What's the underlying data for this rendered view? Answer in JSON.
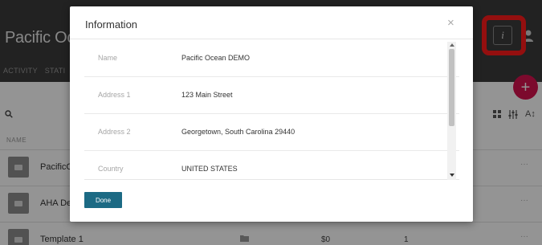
{
  "app": {
    "title": "Pacific Ocea",
    "tabs": [
      "ACTIVITY",
      "STATI"
    ],
    "info_button": "i",
    "add_button": "+",
    "column_header": "NAME",
    "toolbar_sort": "A↕",
    "rows": [
      {
        "name": "PacificOc",
        "col2": "",
        "col3": "",
        "col4": "",
        "more": "···"
      },
      {
        "name": "AHA Der",
        "col2": "",
        "col3": "",
        "col4": "",
        "more": "···"
      },
      {
        "name": "Template 1",
        "col2": "",
        "col3": "$0",
        "col4": "1",
        "more": "···"
      }
    ]
  },
  "modal": {
    "title": "Information",
    "close": "×",
    "fields": [
      {
        "label": "Name",
        "value": "Pacific Ocean DEMO"
      },
      {
        "label": "Address 1",
        "value": "123 Main Street"
      },
      {
        "label": "Address 2",
        "value": "Georgetown, South Carolina 29440"
      },
      {
        "label": "Country",
        "value": "UNITED STATES"
      }
    ],
    "done": "Done"
  },
  "colors": {
    "header_bg": "#3b3b3b",
    "accent": "#d6124f",
    "highlight": "#ff1a1a",
    "done_bg": "#1c6a84"
  }
}
